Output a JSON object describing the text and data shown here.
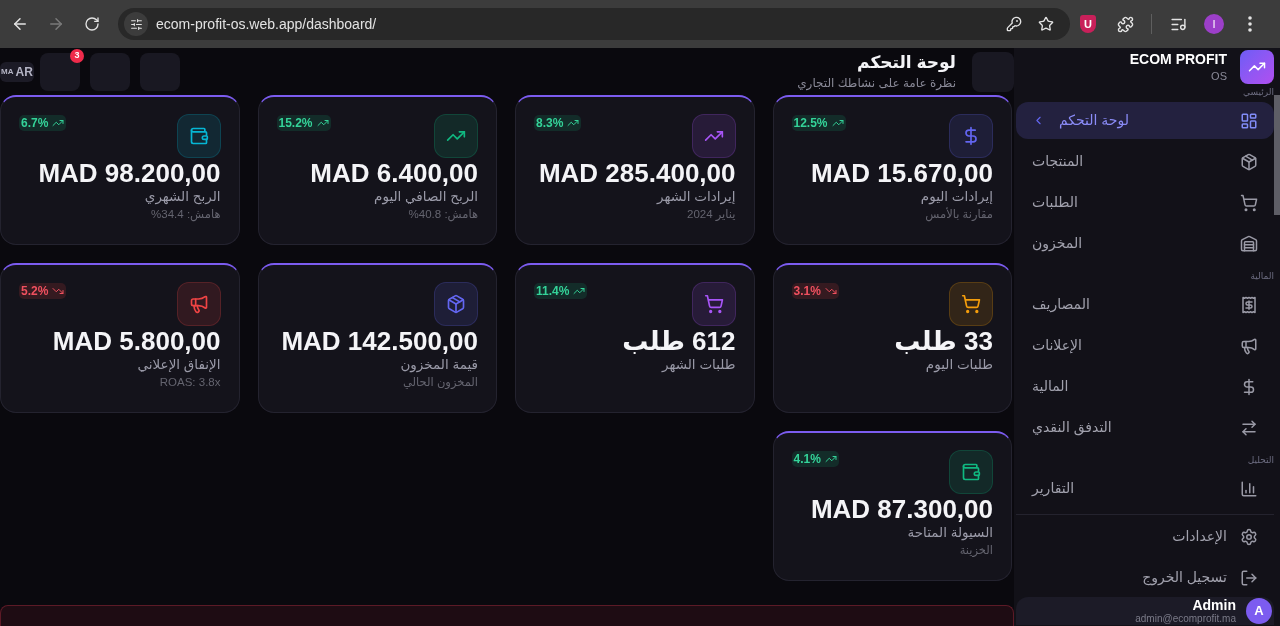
{
  "browser": {
    "url": "ecom-profit-os.web.app/dashboard/",
    "can_go_forward": false,
    "extension_letter": "U",
    "profile_initial": "I"
  },
  "header": {
    "language": {
      "flag": "MA",
      "code": "AR"
    },
    "notification_count": "3",
    "title": "لوحة التحكم",
    "subtitle": "نظرة عامة على نشاطك التجاري"
  },
  "cards": [
    {
      "value": "MAD 15.670,00",
      "label": "إيرادات اليوم",
      "note": "مقارنة بالأمس",
      "change": "12.5%",
      "positive": true,
      "color": "#6366f1"
    },
    {
      "value": "MAD 285.400,00",
      "label": "إيرادات الشهر",
      "note": "يناير 2024",
      "change": "8.3%",
      "positive": true,
      "color": "#a855f7"
    },
    {
      "value": "MAD 6.400,00",
      "label": "الربح الصافي اليوم",
      "note": "هامش: 40.8%",
      "change": "15.2%",
      "positive": true,
      "color": "#10b981"
    },
    {
      "value": "MAD 98.200,00",
      "label": "الربح الشهري",
      "note": "هامش: 34.4%",
      "change": "6.7%",
      "positive": true,
      "color": "#06b6d4"
    },
    {
      "value": "33 طلب",
      "label": "طلبات اليوم",
      "change": "3.1%",
      "positive": false,
      "color": "#f59e0b"
    },
    {
      "value": "612 طلب",
      "label": "طلبات الشهر",
      "change": "11.4%",
      "positive": true,
      "color": "#a855f7"
    },
    {
      "value": "MAD 142.500,00",
      "label": "قيمة المخزون",
      "note": "المخزون الحالي",
      "color": "#6366f1"
    },
    {
      "value": "MAD 5.800,00",
      "label": "الإنفاق الإعلاني",
      "note": "ROAS: 3.8x",
      "change": "5.2%",
      "positive": false,
      "color": "#ef4444"
    },
    {
      "value": "MAD 87.300,00",
      "label": "السيولة المتاحة",
      "note": "الخزينة",
      "change": "4.1%",
      "positive": true,
      "color": "#10b981"
    }
  ],
  "alert_banner": {
    "kind": "error"
  },
  "sidebar": {
    "brand": "ECOM PROFIT",
    "brand_sub": "OS",
    "sections": [
      {
        "label": "الرئيسي",
        "items": [
          {
            "label": "لوحة التحكم",
            "selected": true
          },
          {
            "label": "المنتجات",
            "selected": false
          },
          {
            "label": "الطلبات",
            "selected": false
          },
          {
            "label": "المخزون",
            "selected": false
          }
        ]
      },
      {
        "label": "المالية",
        "items": [
          {
            "label": "المصاريف",
            "selected": false
          },
          {
            "label": "الإعلانات",
            "selected": false
          },
          {
            "label": "المالية",
            "selected": false
          },
          {
            "label": "التدفق النقدي",
            "selected": false
          }
        ]
      },
      {
        "label": "التحليل",
        "items": [
          {
            "label": "التقارير",
            "selected": false
          }
        ]
      }
    ],
    "footer_links": [
      {
        "label": "الإعدادات"
      },
      {
        "label": "تسجيل الخروج"
      }
    ],
    "user": {
      "initial": "A",
      "name": "Admin",
      "email": "admin@ecomprofit.ma"
    }
  }
}
